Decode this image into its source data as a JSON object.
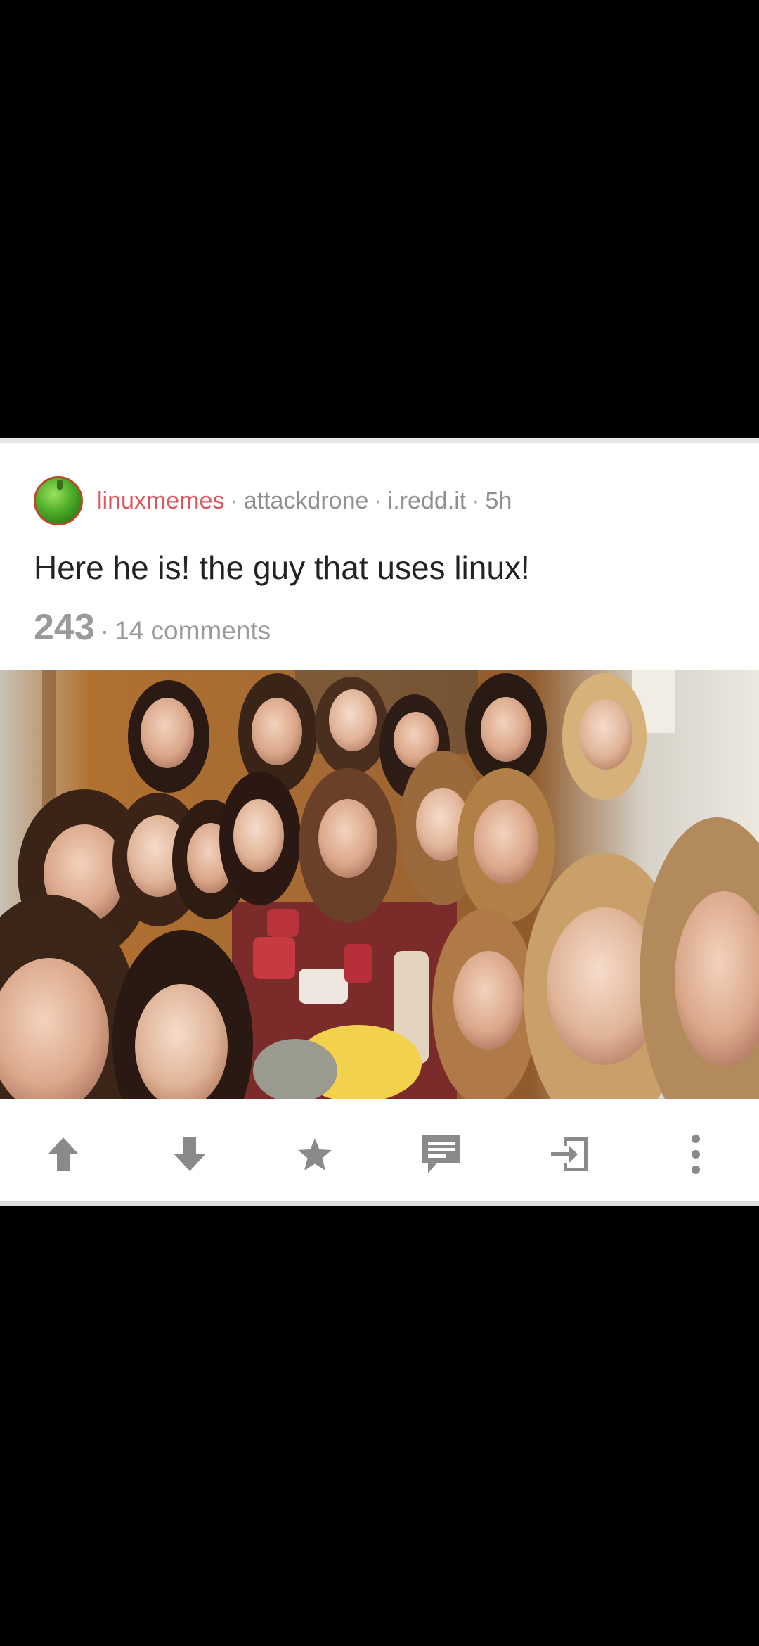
{
  "post": {
    "subreddit": "linuxmemes",
    "author": "attackdrone",
    "domain": "i.redd.it",
    "age": "5h",
    "separator": "·",
    "title": "Here he is! the guy that uses linux!",
    "score": "243",
    "comments": "14 comments",
    "subreddit_icon": "green-bell-pepper-icon",
    "image_description": "group-selfie-photo"
  },
  "actions": [
    {
      "name": "upvote",
      "icon": "arrow-up-icon"
    },
    {
      "name": "downvote",
      "icon": "arrow-down-icon"
    },
    {
      "name": "save",
      "icon": "star-icon"
    },
    {
      "name": "comments",
      "icon": "comment-icon"
    },
    {
      "name": "open",
      "icon": "open-link-icon"
    },
    {
      "name": "more",
      "icon": "more-vertical-icon"
    }
  ],
  "colors": {
    "subreddit": "#e2545c",
    "meta": "#8f8f8f",
    "title": "#222222",
    "icon": "#8a8a8a",
    "background": "#000000",
    "card": "#ffffff"
  }
}
